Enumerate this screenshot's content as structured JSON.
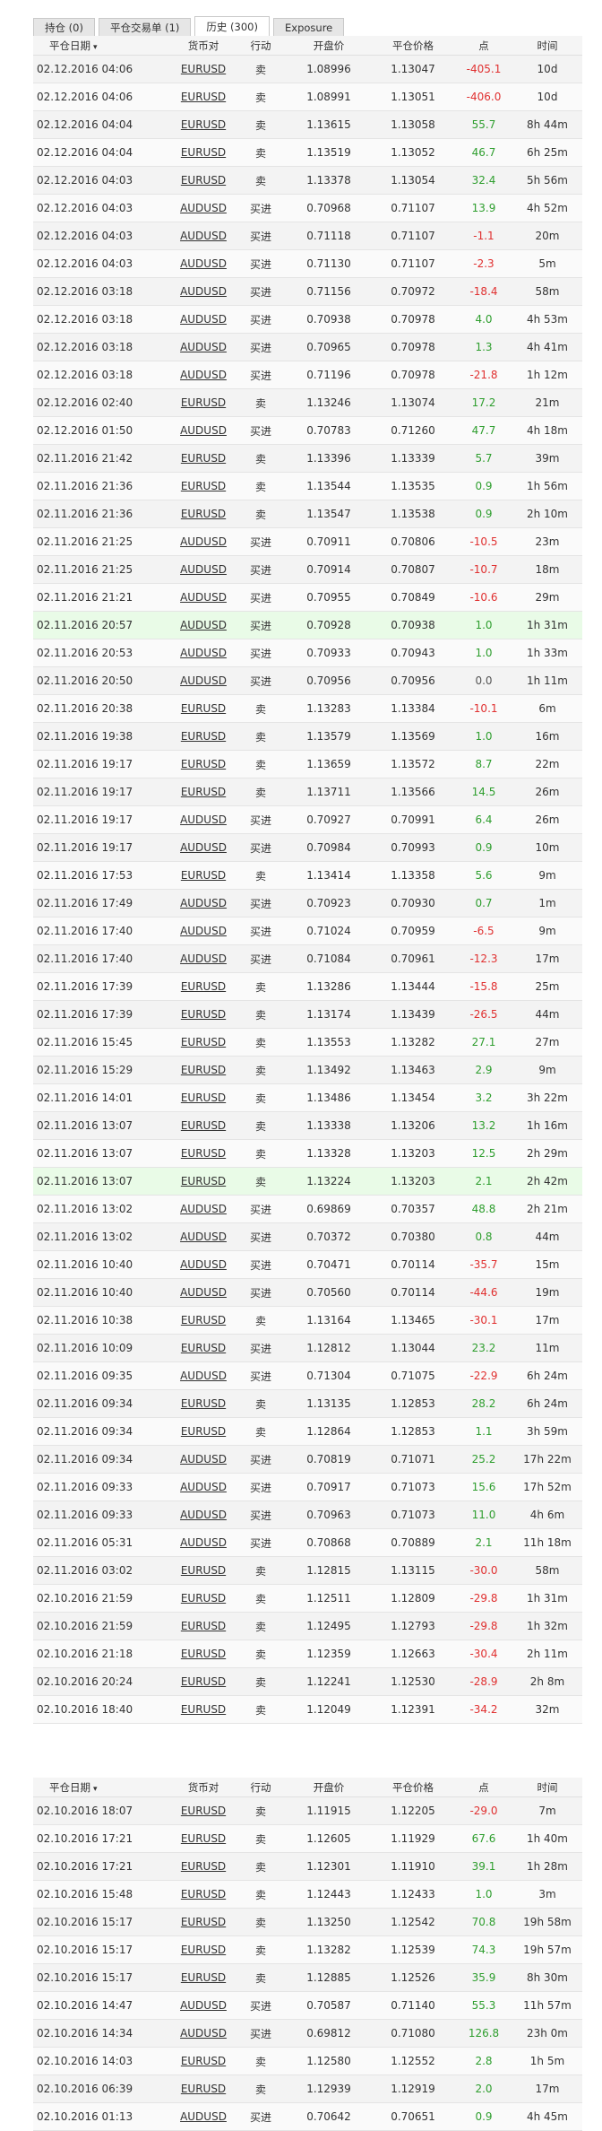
{
  "tabs": [
    {
      "label": "持仓 (0)"
    },
    {
      "label": "平仓交易单 (1)"
    },
    {
      "label": "历史 (300)",
      "active": true
    },
    {
      "label": "Exposure"
    }
  ],
  "columns": [
    "平仓日期",
    "货币对",
    "行动",
    "开盘价",
    "平仓价格",
    "点",
    "时间"
  ],
  "sort_icon": "▾",
  "colors": {
    "positive": "#2e9e2e",
    "negative": "#e03030",
    "highlight_row": "#e9fbe7"
  },
  "rows": [
    [
      "02.12.2016 04:06",
      "EURUSD",
      "卖",
      "1.08996",
      "1.13047",
      "-405.1",
      "10d"
    ],
    [
      "02.12.2016 04:06",
      "EURUSD",
      "卖",
      "1.08991",
      "1.13051",
      "-406.0",
      "10d"
    ],
    [
      "02.12.2016 04:04",
      "EURUSD",
      "卖",
      "1.13615",
      "1.13058",
      "55.7",
      "8h 44m"
    ],
    [
      "02.12.2016 04:04",
      "EURUSD",
      "卖",
      "1.13519",
      "1.13052",
      "46.7",
      "6h 25m"
    ],
    [
      "02.12.2016 04:03",
      "EURUSD",
      "卖",
      "1.13378",
      "1.13054",
      "32.4",
      "5h 56m"
    ],
    [
      "02.12.2016 04:03",
      "AUDUSD",
      "买进",
      "0.70968",
      "0.71107",
      "13.9",
      "4h 52m"
    ],
    [
      "02.12.2016 04:03",
      "AUDUSD",
      "买进",
      "0.71118",
      "0.71107",
      "-1.1",
      "20m"
    ],
    [
      "02.12.2016 04:03",
      "AUDUSD",
      "买进",
      "0.71130",
      "0.71107",
      "-2.3",
      "5m"
    ],
    [
      "02.12.2016 03:18",
      "AUDUSD",
      "买进",
      "0.71156",
      "0.70972",
      "-18.4",
      "58m"
    ],
    [
      "02.12.2016 03:18",
      "AUDUSD",
      "买进",
      "0.70938",
      "0.70978",
      "4.0",
      "4h 53m"
    ],
    [
      "02.12.2016 03:18",
      "AUDUSD",
      "买进",
      "0.70965",
      "0.70978",
      "1.3",
      "4h 41m"
    ],
    [
      "02.12.2016 03:18",
      "AUDUSD",
      "买进",
      "0.71196",
      "0.70978",
      "-21.8",
      "1h 12m"
    ],
    [
      "02.12.2016 02:40",
      "EURUSD",
      "卖",
      "1.13246",
      "1.13074",
      "17.2",
      "21m"
    ],
    [
      "02.12.2016 01:50",
      "AUDUSD",
      "买进",
      "0.70783",
      "0.71260",
      "47.7",
      "4h 18m"
    ],
    [
      "02.11.2016 21:42",
      "EURUSD",
      "卖",
      "1.13396",
      "1.13339",
      "5.7",
      "39m"
    ],
    [
      "02.11.2016 21:36",
      "EURUSD",
      "卖",
      "1.13544",
      "1.13535",
      "0.9",
      "1h 56m"
    ],
    [
      "02.11.2016 21:36",
      "EURUSD",
      "卖",
      "1.13547",
      "1.13538",
      "0.9",
      "2h 10m"
    ],
    [
      "02.11.2016 21:25",
      "AUDUSD",
      "买进",
      "0.70911",
      "0.70806",
      "-10.5",
      "23m"
    ],
    [
      "02.11.2016 21:25",
      "AUDUSD",
      "买进",
      "0.70914",
      "0.70807",
      "-10.7",
      "18m"
    ],
    [
      "02.11.2016 21:21",
      "AUDUSD",
      "买进",
      "0.70955",
      "0.70849",
      "-10.6",
      "29m"
    ],
    [
      "02.11.2016 20:57",
      "AUDUSD",
      "买进",
      "0.70928",
      "0.70938",
      "1.0",
      "1h 31m"
    ],
    [
      "02.11.2016 20:53",
      "AUDUSD",
      "买进",
      "0.70933",
      "0.70943",
      "1.0",
      "1h 33m"
    ],
    [
      "02.11.2016 20:50",
      "AUDUSD",
      "买进",
      "0.70956",
      "0.70956",
      "0.0",
      "1h 11m"
    ],
    [
      "02.11.2016 20:38",
      "EURUSD",
      "卖",
      "1.13283",
      "1.13384",
      "-10.1",
      "6m"
    ],
    [
      "02.11.2016 19:38",
      "EURUSD",
      "卖",
      "1.13579",
      "1.13569",
      "1.0",
      "16m"
    ],
    [
      "02.11.2016 19:17",
      "EURUSD",
      "卖",
      "1.13659",
      "1.13572",
      "8.7",
      "22m"
    ],
    [
      "02.11.2016 19:17",
      "EURUSD",
      "卖",
      "1.13711",
      "1.13566",
      "14.5",
      "26m"
    ],
    [
      "02.11.2016 19:17",
      "AUDUSD",
      "买进",
      "0.70927",
      "0.70991",
      "6.4",
      "26m"
    ],
    [
      "02.11.2016 19:17",
      "AUDUSD",
      "买进",
      "0.70984",
      "0.70993",
      "0.9",
      "10m"
    ],
    [
      "02.11.2016 17:53",
      "EURUSD",
      "卖",
      "1.13414",
      "1.13358",
      "5.6",
      "9m"
    ],
    [
      "02.11.2016 17:49",
      "AUDUSD",
      "买进",
      "0.70923",
      "0.70930",
      "0.7",
      "1m"
    ],
    [
      "02.11.2016 17:40",
      "AUDUSD",
      "买进",
      "0.71024",
      "0.70959",
      "-6.5",
      "9m"
    ],
    [
      "02.11.2016 17:40",
      "AUDUSD",
      "买进",
      "0.71084",
      "0.70961",
      "-12.3",
      "17m"
    ],
    [
      "02.11.2016 17:39",
      "EURUSD",
      "卖",
      "1.13286",
      "1.13444",
      "-15.8",
      "25m"
    ],
    [
      "02.11.2016 17:39",
      "EURUSD",
      "卖",
      "1.13174",
      "1.13439",
      "-26.5",
      "44m"
    ],
    [
      "02.11.2016 15:45",
      "EURUSD",
      "卖",
      "1.13553",
      "1.13282",
      "27.1",
      "27m"
    ],
    [
      "02.11.2016 15:29",
      "EURUSD",
      "卖",
      "1.13492",
      "1.13463",
      "2.9",
      "9m"
    ],
    [
      "02.11.2016 14:01",
      "EURUSD",
      "卖",
      "1.13486",
      "1.13454",
      "3.2",
      "3h 22m"
    ],
    [
      "02.11.2016 13:07",
      "EURUSD",
      "卖",
      "1.13338",
      "1.13206",
      "13.2",
      "1h 16m"
    ],
    [
      "02.11.2016 13:07",
      "EURUSD",
      "卖",
      "1.13328",
      "1.13203",
      "12.5",
      "2h 29m"
    ],
    [
      "02.11.2016 13:07",
      "EURUSD",
      "卖",
      "1.13224",
      "1.13203",
      "2.1",
      "2h 42m"
    ],
    [
      "02.11.2016 13:02",
      "AUDUSD",
      "买进",
      "0.69869",
      "0.70357",
      "48.8",
      "2h 21m"
    ],
    [
      "02.11.2016 13:02",
      "AUDUSD",
      "买进",
      "0.70372",
      "0.70380",
      "0.8",
      "44m"
    ],
    [
      "02.11.2016 10:40",
      "AUDUSD",
      "买进",
      "0.70471",
      "0.70114",
      "-35.7",
      "15m"
    ],
    [
      "02.11.2016 10:40",
      "AUDUSD",
      "买进",
      "0.70560",
      "0.70114",
      "-44.6",
      "19m"
    ],
    [
      "02.11.2016 10:38",
      "EURUSD",
      "卖",
      "1.13164",
      "1.13465",
      "-30.1",
      "17m"
    ],
    [
      "02.11.2016 10:09",
      "EURUSD",
      "买进",
      "1.12812",
      "1.13044",
      "23.2",
      "11m"
    ],
    [
      "02.11.2016 09:35",
      "AUDUSD",
      "买进",
      "0.71304",
      "0.71075",
      "-22.9",
      "6h 24m"
    ],
    [
      "02.11.2016 09:34",
      "EURUSD",
      "卖",
      "1.13135",
      "1.12853",
      "28.2",
      "6h 24m"
    ],
    [
      "02.11.2016 09:34",
      "EURUSD",
      "卖",
      "1.12864",
      "1.12853",
      "1.1",
      "3h 59m"
    ],
    [
      "02.11.2016 09:34",
      "AUDUSD",
      "买进",
      "0.70819",
      "0.71071",
      "25.2",
      "17h 22m"
    ],
    [
      "02.11.2016 09:33",
      "AUDUSD",
      "买进",
      "0.70917",
      "0.71073",
      "15.6",
      "17h 52m"
    ],
    [
      "02.11.2016 09:33",
      "AUDUSD",
      "买进",
      "0.70963",
      "0.71073",
      "11.0",
      "4h 6m"
    ],
    [
      "02.11.2016 05:31",
      "AUDUSD",
      "买进",
      "0.70868",
      "0.70889",
      "2.1",
      "11h 18m"
    ],
    [
      "02.11.2016 03:02",
      "EURUSD",
      "卖",
      "1.12815",
      "1.13115",
      "-30.0",
      "58m"
    ],
    [
      "02.10.2016 21:59",
      "EURUSD",
      "卖",
      "1.12511",
      "1.12809",
      "-29.8",
      "1h 31m"
    ],
    [
      "02.10.2016 21:59",
      "EURUSD",
      "卖",
      "1.12495",
      "1.12793",
      "-29.8",
      "1h 32m"
    ],
    [
      "02.10.2016 21:18",
      "EURUSD",
      "卖",
      "1.12359",
      "1.12663",
      "-30.4",
      "2h 11m"
    ],
    [
      "02.10.2016 20:24",
      "EURUSD",
      "卖",
      "1.12241",
      "1.12530",
      "-28.9",
      "2h 8m"
    ],
    [
      "02.10.2016 18:40",
      "EURUSD",
      "卖",
      "1.12049",
      "1.12391",
      "-34.2",
      "32m"
    ]
  ],
  "rows_b": [
    [
      "02.10.2016 18:07",
      "EURUSD",
      "卖",
      "1.11915",
      "1.12205",
      "-29.0",
      "7m"
    ],
    [
      "02.10.2016 17:21",
      "EURUSD",
      "卖",
      "1.12605",
      "1.11929",
      "67.6",
      "1h 40m"
    ],
    [
      "02.10.2016 17:21",
      "EURUSD",
      "卖",
      "1.12301",
      "1.11910",
      "39.1",
      "1h 28m"
    ],
    [
      "02.10.2016 15:48",
      "EURUSD",
      "卖",
      "1.12443",
      "1.12433",
      "1.0",
      "3m"
    ],
    [
      "02.10.2016 15:17",
      "EURUSD",
      "卖",
      "1.13250",
      "1.12542",
      "70.8",
      "19h 58m"
    ],
    [
      "02.10.2016 15:17",
      "EURUSD",
      "卖",
      "1.13282",
      "1.12539",
      "74.3",
      "19h 57m"
    ],
    [
      "02.10.2016 15:17",
      "EURUSD",
      "卖",
      "1.12885",
      "1.12526",
      "35.9",
      "8h 30m"
    ],
    [
      "02.10.2016 14:47",
      "AUDUSD",
      "买进",
      "0.70587",
      "0.71140",
      "55.3",
      "11h 57m"
    ],
    [
      "02.10.2016 14:34",
      "AUDUSD",
      "买进",
      "0.69812",
      "0.71080",
      "126.8",
      "23h 0m"
    ],
    [
      "02.10.2016 14:03",
      "EURUSD",
      "卖",
      "1.12580",
      "1.12552",
      "2.8",
      "1h 5m"
    ],
    [
      "02.10.2016 06:39",
      "EURUSD",
      "卖",
      "1.12939",
      "1.12919",
      "2.0",
      "17m"
    ],
    [
      "02.10.2016 01:13",
      "AUDUSD",
      "买进",
      "0.70642",
      "0.70651",
      "0.9",
      "4h 45m"
    ]
  ]
}
